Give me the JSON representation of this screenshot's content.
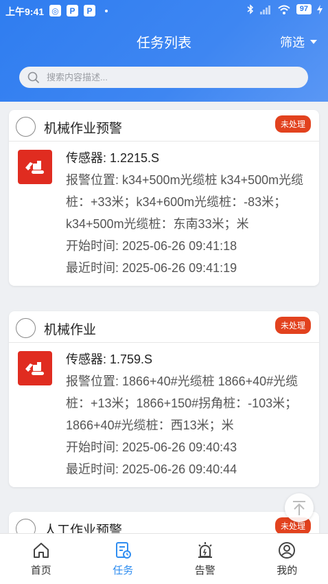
{
  "status_bar": {
    "time": "上午9:41",
    "battery": "97"
  },
  "header": {
    "title": "任务列表",
    "filter_label": "筛选"
  },
  "search": {
    "placeholder": "搜索内容描述..."
  },
  "cards": [
    {
      "title": "机械作业预警",
      "badge": "未处理",
      "sensor": "传感器: 1.2215.S",
      "location": "报警位置: k34+500m光缆桩 k34+500m光缆桩：+33米；k34+600m光缆桩：-83米；k34+500m光缆桩：东南33米；米",
      "start_time": "开始时间: 2025-06-26 09:41:18",
      "latest_time": "最近时间: 2025-06-26 09:41:19"
    },
    {
      "title": "机械作业",
      "badge": "未处理",
      "sensor": "传感器: 1.759.S",
      "location": "报警位置: 1866+40#光缆桩 1866+40#光缆桩：+13米；1866+150#拐角桩：-103米；1866+40#光缆桩：西13米；米",
      "start_time": "开始时间: 2025-06-26 09:40:43",
      "latest_time": "最近时间: 2025-06-26 09:40:44"
    },
    {
      "title": "人工作业预警",
      "badge": "未处理"
    }
  ],
  "tabs": [
    {
      "label": "首页",
      "icon": "home-icon"
    },
    {
      "label": "任务",
      "icon": "task-icon"
    },
    {
      "label": "告警",
      "icon": "alarm-icon"
    },
    {
      "label": "我的",
      "icon": "profile-icon"
    }
  ],
  "colors": {
    "primary": "#2f7df0",
    "badge": "#e2421e",
    "active_tab": "#2f8df0",
    "alarm_icon": "#e02c20"
  }
}
